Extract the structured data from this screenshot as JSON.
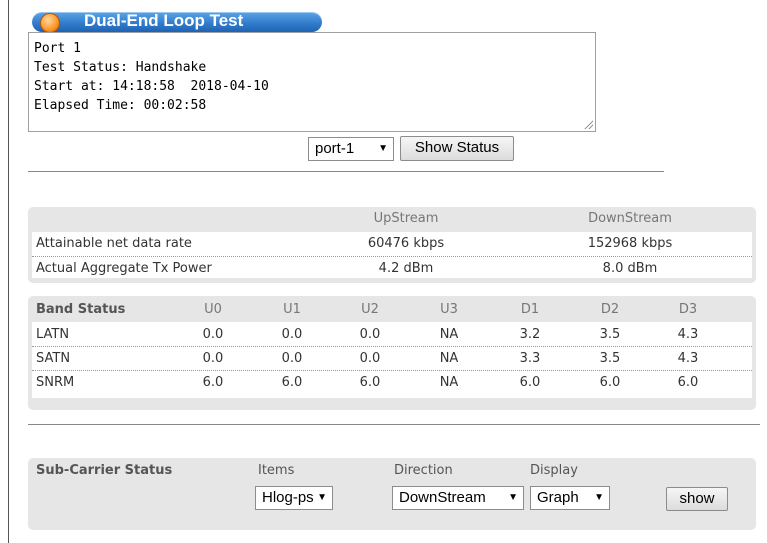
{
  "title": "Dual-End Loop Test",
  "status_lines": [
    "Port 1",
    "Test Status: Handshake",
    "Start at: 14:18:58  2018-04-10",
    "Elapsed Time: 00:02:58"
  ],
  "port_select": {
    "value": "port-1"
  },
  "show_status_label": "Show Status",
  "rate_table": {
    "headers": [
      "",
      "UpStream",
      "DownStream"
    ],
    "rows": [
      {
        "label": "Attainable net data rate",
        "up": "60476 kbps",
        "down": "152968 kbps"
      },
      {
        "label": "Actual Aggregate Tx Power",
        "up": "4.2 dBm",
        "down": "8.0 dBm"
      }
    ]
  },
  "band_table": {
    "headers": [
      "Band Status",
      "U0",
      "U1",
      "U2",
      "U3",
      "D1",
      "D2",
      "D3"
    ],
    "rows": [
      {
        "label": "LATN",
        "values": [
          "0.0",
          "0.0",
          "0.0",
          "NA",
          "3.2",
          "3.5",
          "4.3"
        ]
      },
      {
        "label": "SATN",
        "values": [
          "0.0",
          "0.0",
          "0.0",
          "NA",
          "3.3",
          "3.5",
          "4.3"
        ]
      },
      {
        "label": "SNRM",
        "values": [
          "6.0",
          "6.0",
          "6.0",
          "NA",
          "6.0",
          "6.0",
          "6.0"
        ]
      }
    ]
  },
  "subcarrier": {
    "label": "Sub-Carrier Status",
    "items_label": "Items",
    "direction_label": "Direction",
    "display_label": "Display",
    "items_value": "Hlog-ps",
    "direction_value": "DownStream",
    "display_value": "Graph",
    "show_label": "show"
  }
}
